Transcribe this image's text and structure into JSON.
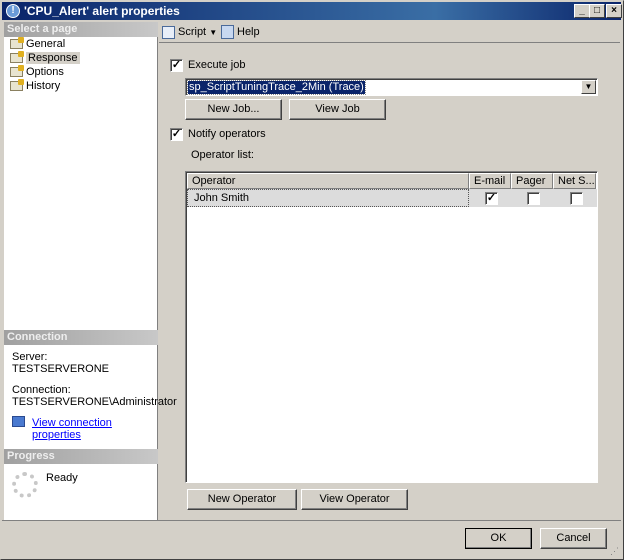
{
  "window": {
    "title": "'CPU_Alert' alert properties",
    "controls": {
      "minimize": "_",
      "maximize": "□",
      "close": "×"
    }
  },
  "left_pane": {
    "select_header": "Select a page",
    "pages": [
      {
        "label": "General"
      },
      {
        "label": "Response",
        "selected": true
      },
      {
        "label": "Options"
      },
      {
        "label": "History"
      }
    ],
    "connection": {
      "header": "Connection",
      "server_label": "Server:",
      "server": "TESTSERVERONE",
      "connection_label": "Connection:",
      "connection": "TESTSERVERONE\\Administrator",
      "link": "View connection properties"
    },
    "progress": {
      "header": "Progress",
      "status": "Ready"
    }
  },
  "toolbar": {
    "script": "Script",
    "help": "Help"
  },
  "response": {
    "execute_job": {
      "label": "Execute job",
      "checked": true
    },
    "job_select": "sp_ScriptTuningTrace_2Min (Trace)",
    "new_job": "New Job...",
    "view_job": "View Job",
    "notify_operators": {
      "label": "Notify operators",
      "checked": true
    },
    "operator_list_label": "Operator list:",
    "grid": {
      "columns": [
        "Operator",
        "E-mail",
        "Pager",
        "Net S..."
      ],
      "rows": [
        {
          "operator": "John Smith",
          "email": true,
          "pager": false,
          "net_send": false
        }
      ]
    },
    "new_operator": "New Operator",
    "view_operator": "View Operator"
  },
  "footer": {
    "ok": "OK",
    "cancel": "Cancel"
  },
  "colors": {
    "titlebar": "#0a246a",
    "selection": "#0a246a",
    "link": "#0000ff"
  }
}
